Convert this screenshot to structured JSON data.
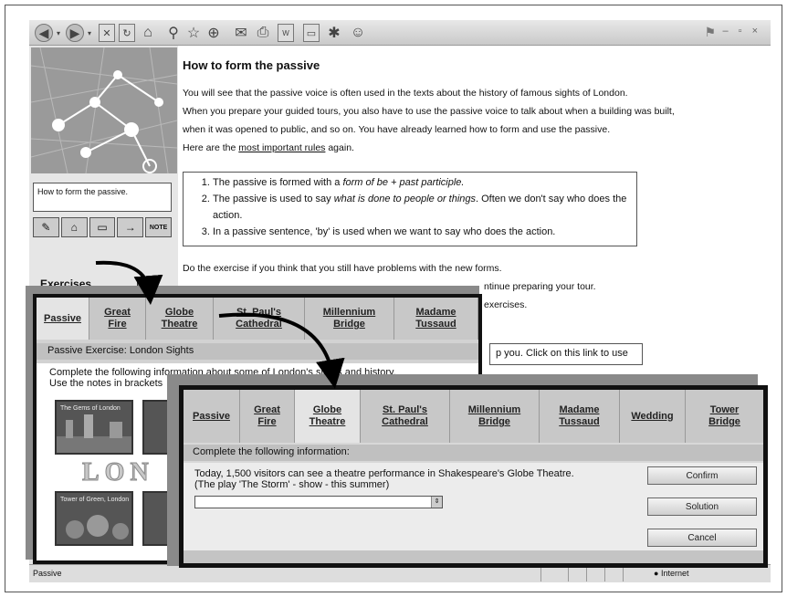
{
  "left": {
    "nav_label": "How to form the passive.",
    "note_icon": "NOTE",
    "exercises": "Exercises"
  },
  "content": {
    "title": "How to form the passive",
    "intro": [
      "You will see that the passive voice is often used in the texts about the history of famous sights of London.",
      "When you prepare your guided tours, you also have to use the passive voice to talk about when a building was built,",
      " when it was opened to public, and so on. You have already learned how to form and use the passive."
    ],
    "rules_line_pre": "Here are the ",
    "rules_link": "most important rules",
    "rules_line_post": " again.",
    "rules": {
      "r1_a": "The passive is formed with a ",
      "r1_b": "form of be + past participle.",
      "r2_a": "The passive is used to say ",
      "r2_b": "what is done to people or things",
      "r2_c": ". Often we don't say who does the action.",
      "r3": "In a passive sentence, 'by' is used when we want to say who does the action."
    },
    "do_exercise": "Do the exercise if you think that you still have problems with the new forms.",
    "peek_1": "ntinue preparing your tour.",
    "peek_2": "exercises.",
    "link_box_text": "p you. Click on this link to use"
  },
  "statusbar": {
    "left": "Passive",
    "right": "Internet"
  },
  "overlay1": {
    "tabs": [
      "Passive",
      "Great\nFire",
      "Globe\nTheatre",
      "St. Paul's\nCathedral",
      "Millennium\nBridge",
      "Madame\nTussaud"
    ],
    "subtitle": "Passive Exercise: London Sights",
    "line1": "Complete the following information about some of London's sights and history.",
    "line2": "Use the notes in brackets",
    "img1_caption": "The Gems of London",
    "img2_caption": "Tower of Green, London",
    "lon": "LON"
  },
  "overlay2": {
    "tabs": [
      "Passive",
      "Great\nFire",
      "Globe\nTheatre",
      "St. Paul's\nCathedral",
      "Millennium\nBridge",
      "Madame\nTussaud",
      "Wedding",
      "Tower\nBridge"
    ],
    "subtitle": "Complete the following information:",
    "question_1": "Today, 1,500 visitors can see a theatre performance in Shakespeare's Globe Theatre.",
    "question_2": "(The play 'The Storm' - show - this summer)",
    "confirm": "Confirm",
    "solution": "Solution",
    "cancel": "Cancel"
  }
}
